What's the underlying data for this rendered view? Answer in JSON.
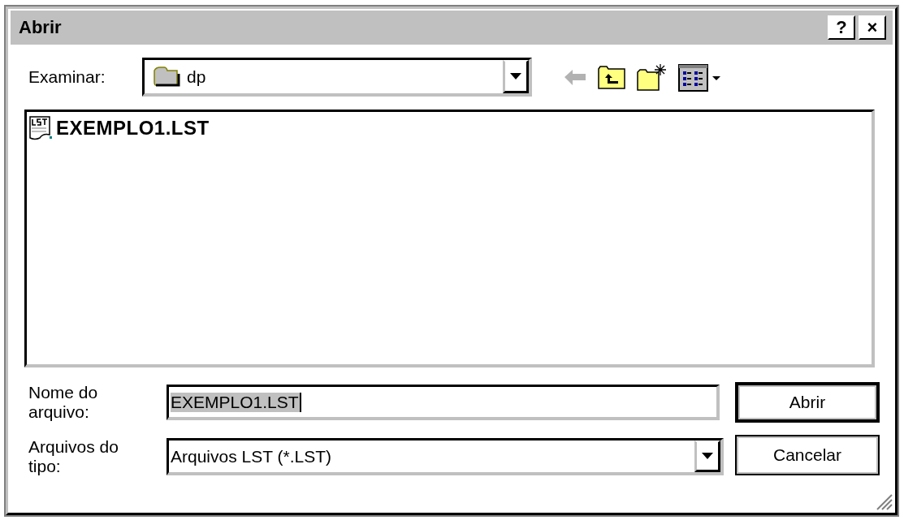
{
  "window": {
    "title": "Abrir",
    "title_buttons": [
      "?",
      "×"
    ]
  },
  "look_in": {
    "label": "Examinar:",
    "value": "dp"
  },
  "toolbar": [
    {
      "kind": "back",
      "disabled": true
    },
    {
      "kind": "up",
      "disabled": false
    },
    {
      "kind": "newfolder",
      "disabled": false
    },
    {
      "kind": "view",
      "disabled": false
    }
  ],
  "files": [
    {
      "name": "EXEMPLO1.LST",
      "selected": false
    }
  ],
  "file_name": {
    "label_lines": [
      "Nome do",
      "arquivo:"
    ],
    "value": "EXEMPLO1.LST",
    "value_selected": true
  },
  "file_type": {
    "label_lines": [
      "Arquivos do",
      "tipo:"
    ],
    "value": "Arquivos LST (*.LST)"
  },
  "buttons": [
    {
      "label": "Abrir",
      "default": true
    },
    {
      "label": "Cancelar",
      "default": false
    }
  ]
}
